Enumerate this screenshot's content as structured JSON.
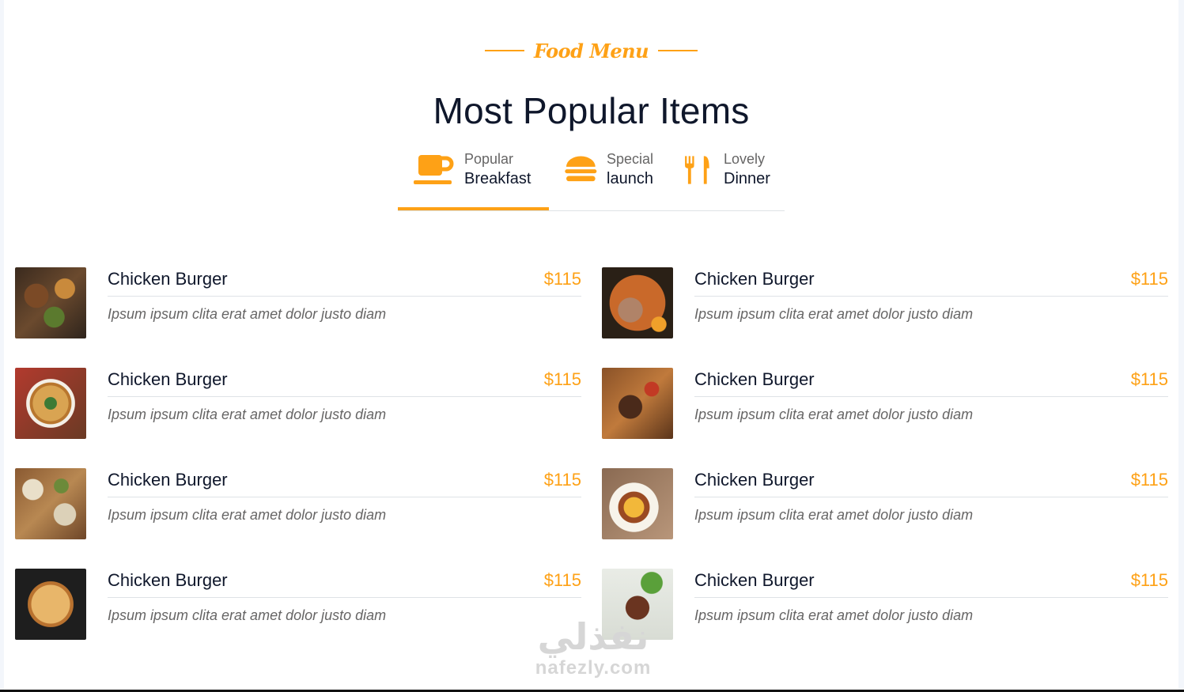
{
  "header": {
    "subtitle": "Food Menu",
    "title": "Most Popular Items"
  },
  "tabs": [
    {
      "small": "Popular",
      "big": "Breakfast",
      "icon": "coffee-cup-icon",
      "active": true
    },
    {
      "small": "Special",
      "big": "launch",
      "icon": "hamburger-icon",
      "active": false
    },
    {
      "small": "Lovely",
      "big": "Dinner",
      "icon": "utensils-icon",
      "active": false
    }
  ],
  "menu": {
    "items": [
      {
        "name": "Chicken Burger",
        "price": "$115",
        "desc": "Ipsum ipsum clita erat amet dolor justo diam",
        "image": "grilled-platter-photo"
      },
      {
        "name": "Chicken Burger",
        "price": "$115",
        "desc": "Ipsum ipsum clita erat amet dolor justo diam",
        "image": "ramen-bowl-photo"
      },
      {
        "name": "Chicken Burger",
        "price": "$115",
        "desc": "Ipsum ipsum clita erat amet dolor justo diam",
        "image": "pizza-plate-photo"
      },
      {
        "name": "Chicken Burger",
        "price": "$115",
        "desc": "Ipsum ipsum clita erat amet dolor justo diam",
        "image": "steak-board-photo"
      },
      {
        "name": "Chicken Burger",
        "price": "$115",
        "desc": "Ipsum ipsum clita erat amet dolor justo diam",
        "image": "table-spread-photo"
      },
      {
        "name": "Chicken Burger",
        "price": "$115",
        "desc": "Ipsum ipsum clita erat amet dolor justo diam",
        "image": "fries-steak-plate-photo"
      },
      {
        "name": "Chicken Burger",
        "price": "$115",
        "desc": "Ipsum ipsum clita erat amet dolor justo diam",
        "image": "pizza-photo"
      },
      {
        "name": "Chicken Burger",
        "price": "$115",
        "desc": "Ipsum ipsum clita erat amet dolor justo diam",
        "image": "sliced-meat-salad-photo"
      }
    ]
  },
  "watermark": {
    "arabic": "نفذلي",
    "latin": "nafezly.com"
  },
  "colors": {
    "accent": "#fea116",
    "heading": "#0f172b",
    "body": "#666565",
    "divider": "#dee2e6"
  }
}
